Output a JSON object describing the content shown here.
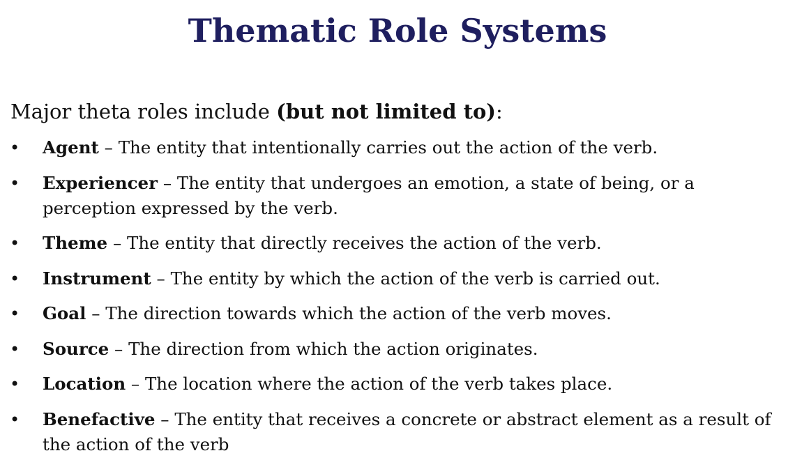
{
  "title": "Thematic Role Systems",
  "intro": {
    "text": "Major theta roles include ",
    "emphasis": "(but not limited to)",
    "suffix": ":"
  },
  "bullet_glyph": "•",
  "separator": " – ",
  "colors": {
    "title": "#1f1f5f",
    "body_text": "#111111",
    "background": "#ffffff"
  },
  "roles": [
    {
      "term": "Agent",
      "definition": "The entity that intentionally carries out the action of the verb."
    },
    {
      "term": "Experiencer",
      "definition": "The entity that undergoes an emotion, a state of being, or a perception expressed by the verb."
    },
    {
      "term": "Theme",
      "definition": "The entity that directly receives the action of the verb."
    },
    {
      "term": "Instrument",
      "definition": "The entity by which the action of the verb is carried out."
    },
    {
      "term": "Goal",
      "definition": "The direction towards which the action of the verb moves."
    },
    {
      "term": "Source",
      "definition": "The direction from which the action originates."
    },
    {
      "term": "Location",
      "definition": "The location where the action of the verb takes place."
    },
    {
      "term": "Benefactive",
      "definition": "The entity that receives a concrete or abstract element as a result of the action of the verb"
    }
  ]
}
